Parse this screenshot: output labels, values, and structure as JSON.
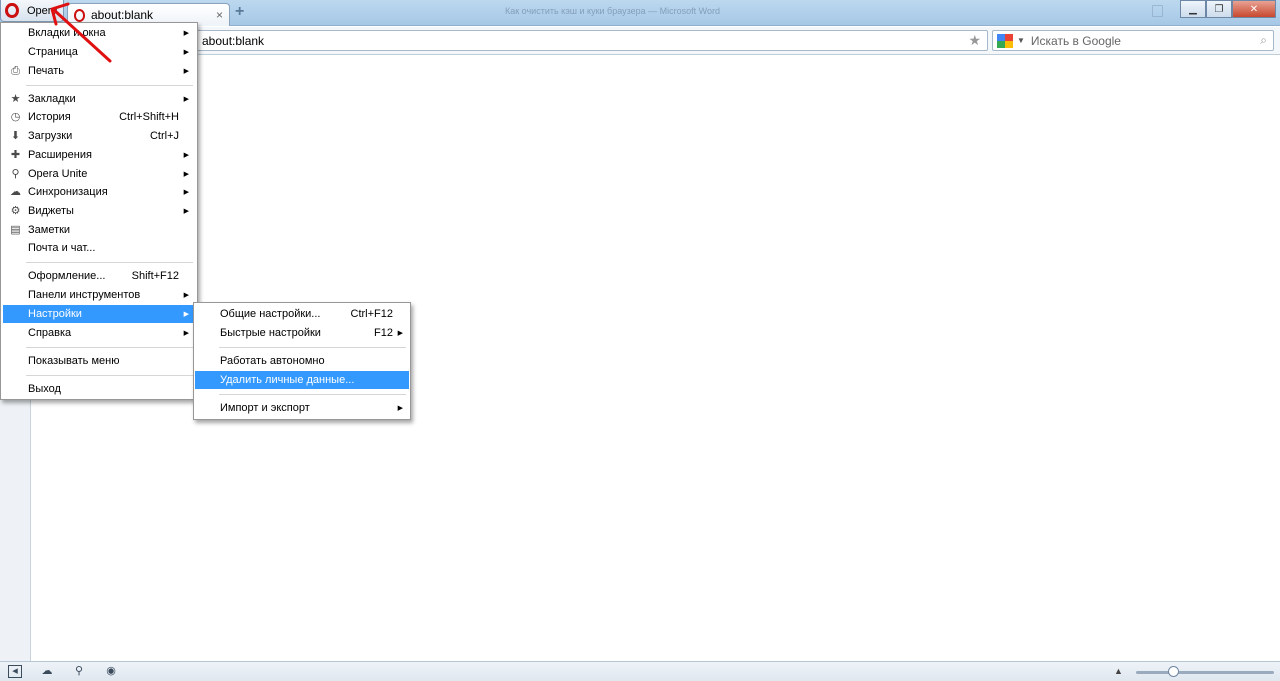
{
  "window": {
    "title": "Как очистить кэш и куки браузера — Microsoft Word"
  },
  "opera_button": {
    "label": "Opera"
  },
  "tab": {
    "title": "about:blank",
    "close": "×"
  },
  "address_bar": {
    "url": "about:blank"
  },
  "search": {
    "placeholder": "Искать в Google"
  },
  "main_menu": {
    "items": [
      {
        "label": "Вкладки и окна",
        "icon": "",
        "shortcut": "",
        "submenu": true
      },
      {
        "label": "Страница",
        "icon": "",
        "shortcut": "",
        "submenu": true
      },
      {
        "label": "Печать",
        "icon": "printer-icon",
        "shortcut": "",
        "submenu": true
      },
      {
        "label": "Закладки",
        "icon": "star-icon",
        "shortcut": "",
        "submenu": true
      },
      {
        "label": "История",
        "icon": "clock-icon",
        "shortcut": "Ctrl+Shift+H",
        "submenu": false
      },
      {
        "label": "Загрузки",
        "icon": "download-icon",
        "shortcut": "Ctrl+J",
        "submenu": false
      },
      {
        "label": "Расширения",
        "icon": "puzzle-icon",
        "shortcut": "",
        "submenu": true
      },
      {
        "label": "Opera Unite",
        "icon": "unite-icon",
        "shortcut": "",
        "submenu": true
      },
      {
        "label": "Синхронизация",
        "icon": "cloud-icon",
        "shortcut": "",
        "submenu": true
      },
      {
        "label": "Виджеты",
        "icon": "gear-icon",
        "shortcut": "",
        "submenu": true
      },
      {
        "label": "Заметки",
        "icon": "note-icon",
        "shortcut": "",
        "submenu": false
      },
      {
        "label": "Почта и чат...",
        "icon": "",
        "shortcut": "",
        "submenu": false
      },
      {
        "label": "Оформление...",
        "icon": "",
        "shortcut": "Shift+F12",
        "submenu": false
      },
      {
        "label": "Панели инструментов",
        "icon": "",
        "shortcut": "",
        "submenu": true
      },
      {
        "label": "Настройки",
        "icon": "",
        "shortcut": "",
        "submenu": true
      },
      {
        "label": "Справка",
        "icon": "",
        "shortcut": "",
        "submenu": true
      },
      {
        "label": "Показывать меню",
        "icon": "",
        "shortcut": "",
        "submenu": false
      },
      {
        "label": "Выход",
        "icon": "",
        "shortcut": "",
        "submenu": false
      }
    ]
  },
  "settings_submenu": {
    "items": [
      {
        "label": "Общие настройки...",
        "shortcut": "Ctrl+F12",
        "submenu": false
      },
      {
        "label": "Быстрые настройки",
        "shortcut": "F12",
        "submenu": true
      },
      {
        "label": "Работать автономно",
        "shortcut": "",
        "submenu": false
      },
      {
        "label": "Удалить личные данные...",
        "shortcut": "",
        "submenu": false
      },
      {
        "label": "Импорт и экспорт",
        "shortcut": "",
        "submenu": true
      }
    ]
  },
  "colors": {
    "highlight": "#3399ff",
    "opera_red": "#cc1010",
    "annotation_arrow": "#e01010"
  }
}
